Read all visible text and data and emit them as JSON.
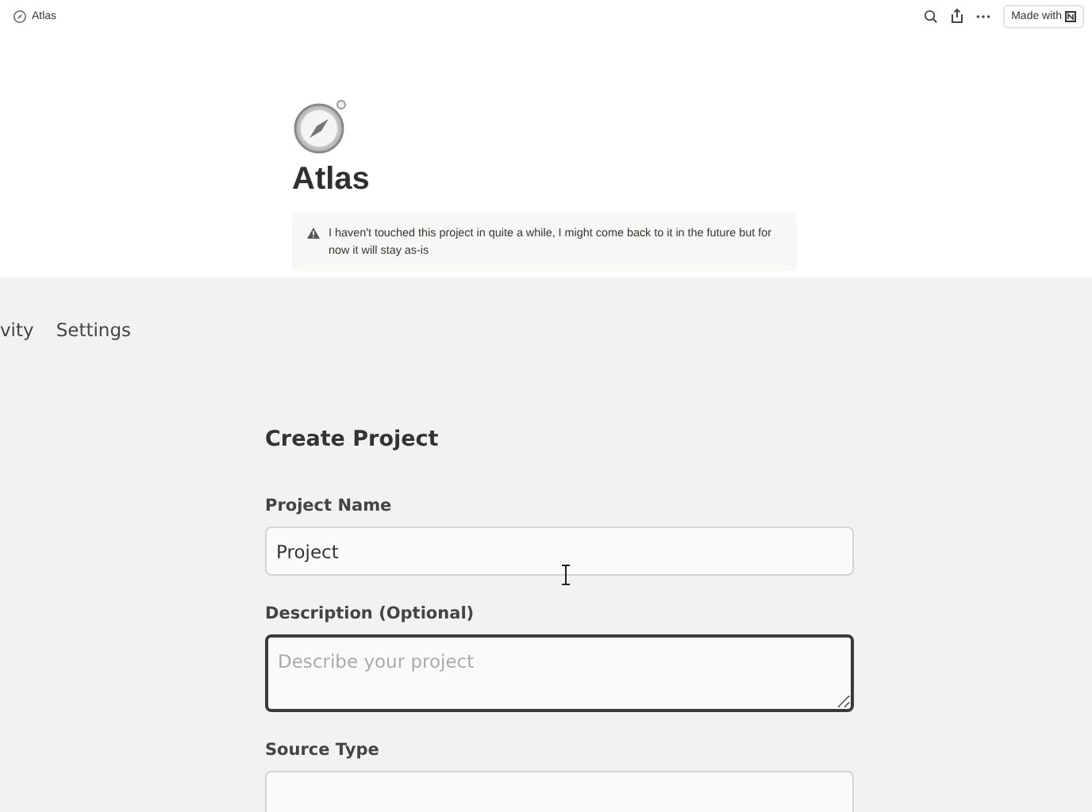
{
  "topbar": {
    "page_title": "Atlas",
    "made_with": "Made with"
  },
  "page": {
    "title": "Atlas",
    "callout": "I haven't touched this project in quite a while, I might come back to it in the future but for now it will stay as-is"
  },
  "embedded_app": {
    "tabs": [
      {
        "label": "vity",
        "selected": false
      },
      {
        "label": "Settings",
        "selected": false
      }
    ],
    "form_title": "Create Project",
    "fields": [
      {
        "kind": "text",
        "label": "Project Name",
        "value": "Project",
        "focused": false
      },
      {
        "kind": "textarea",
        "label": "Description (Optional)",
        "placeholder": "Describe your project",
        "focused": true
      },
      {
        "kind": "text",
        "label": "Source Type",
        "focused": false
      }
    ]
  }
}
